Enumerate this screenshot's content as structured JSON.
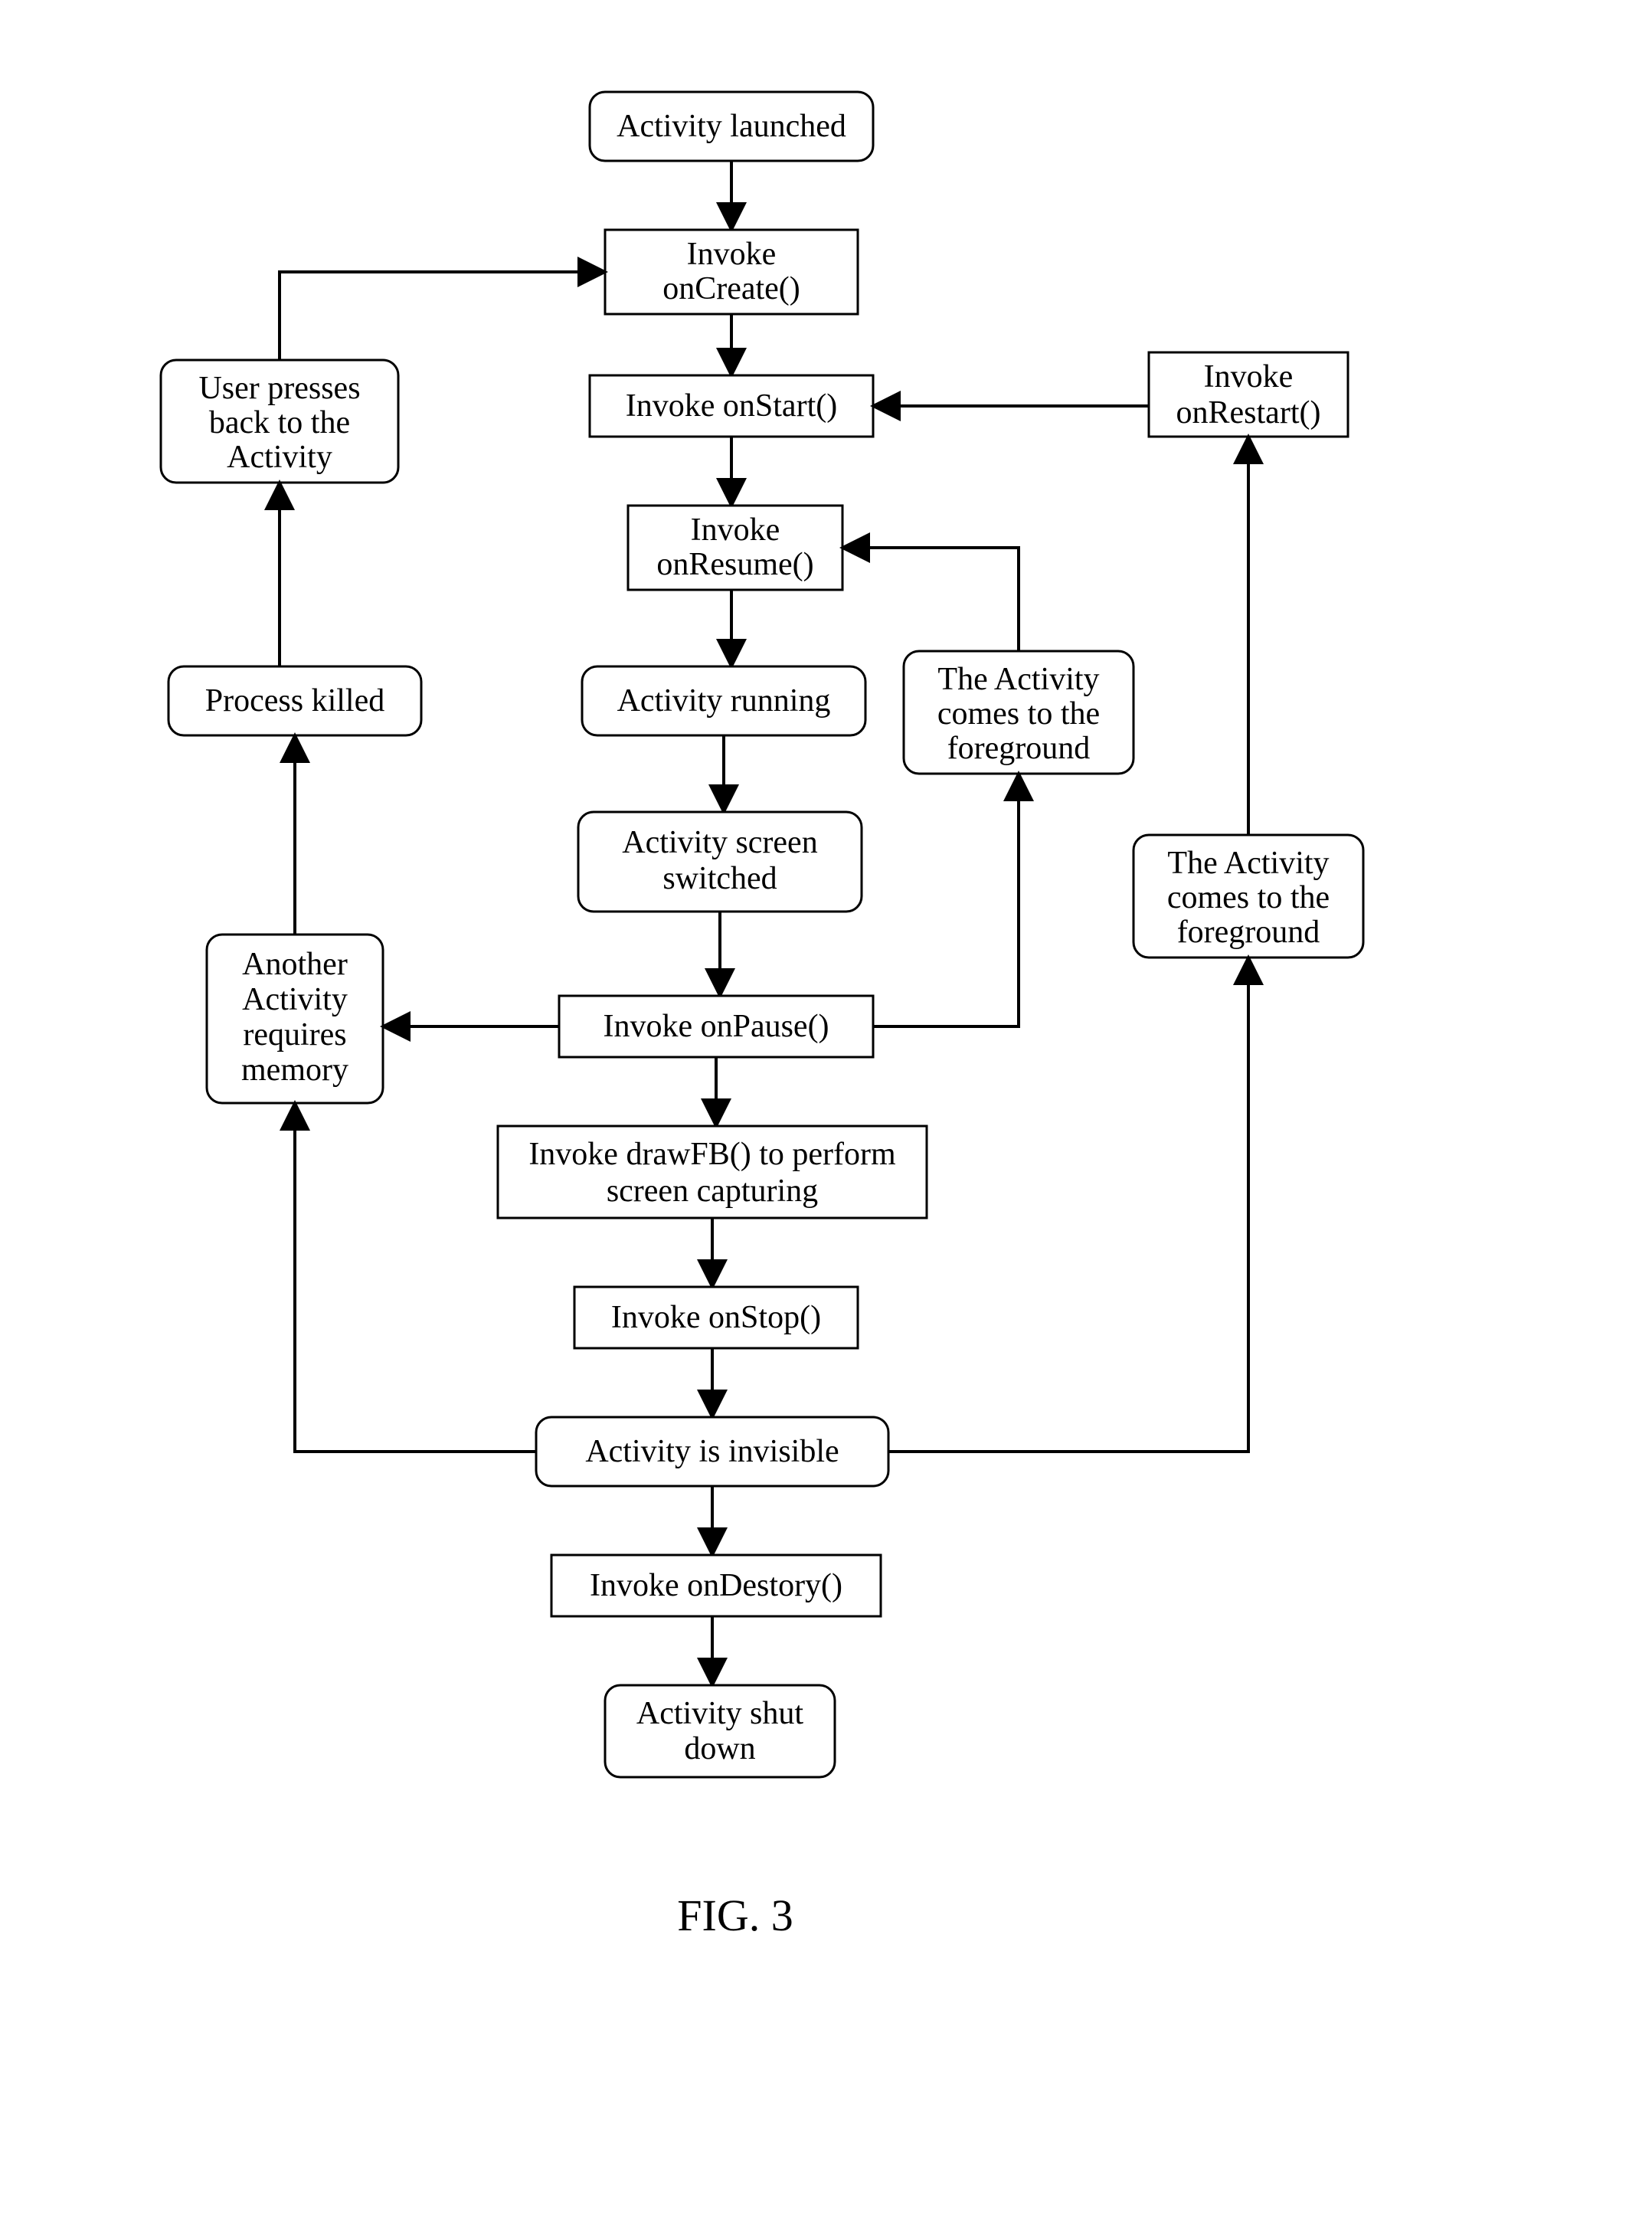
{
  "caption": "FIG. 3",
  "nodes": {
    "launched": "Activity launched",
    "onCreate_l1": "Invoke",
    "onCreate_l2": "onCreate()",
    "onStart": "Invoke onStart()",
    "onResume_l1": "Invoke",
    "onResume_l2": "onResume()",
    "running": "Activity running",
    "switched_l1": "Activity screen",
    "switched_l2": "switched",
    "onPause": "Invoke onPause()",
    "drawFB_l1": "Invoke drawFB() to perform",
    "drawFB_l2": "screen capturing",
    "onStop": "Invoke onStop()",
    "invisible": "Activity is invisible",
    "onDestroy": "Invoke onDestory()",
    "shutdown_l1": "Activity shut",
    "shutdown_l2": "down",
    "onRestart_l1": "Invoke",
    "onRestart_l2": "onRestart()",
    "fg1_l1": "The Activity",
    "fg1_l2": "comes to the",
    "fg1_l3": "foreground",
    "fg2_l1": "The Activity",
    "fg2_l2": "comes to the",
    "fg2_l3": "foreground",
    "reqmem_l1": "Another",
    "reqmem_l2": "Activity",
    "reqmem_l3": "requires",
    "reqmem_l4": "memory",
    "killed": "Process killed",
    "back_l1": "User presses",
    "back_l2": "back to the",
    "back_l3": "Activity"
  }
}
